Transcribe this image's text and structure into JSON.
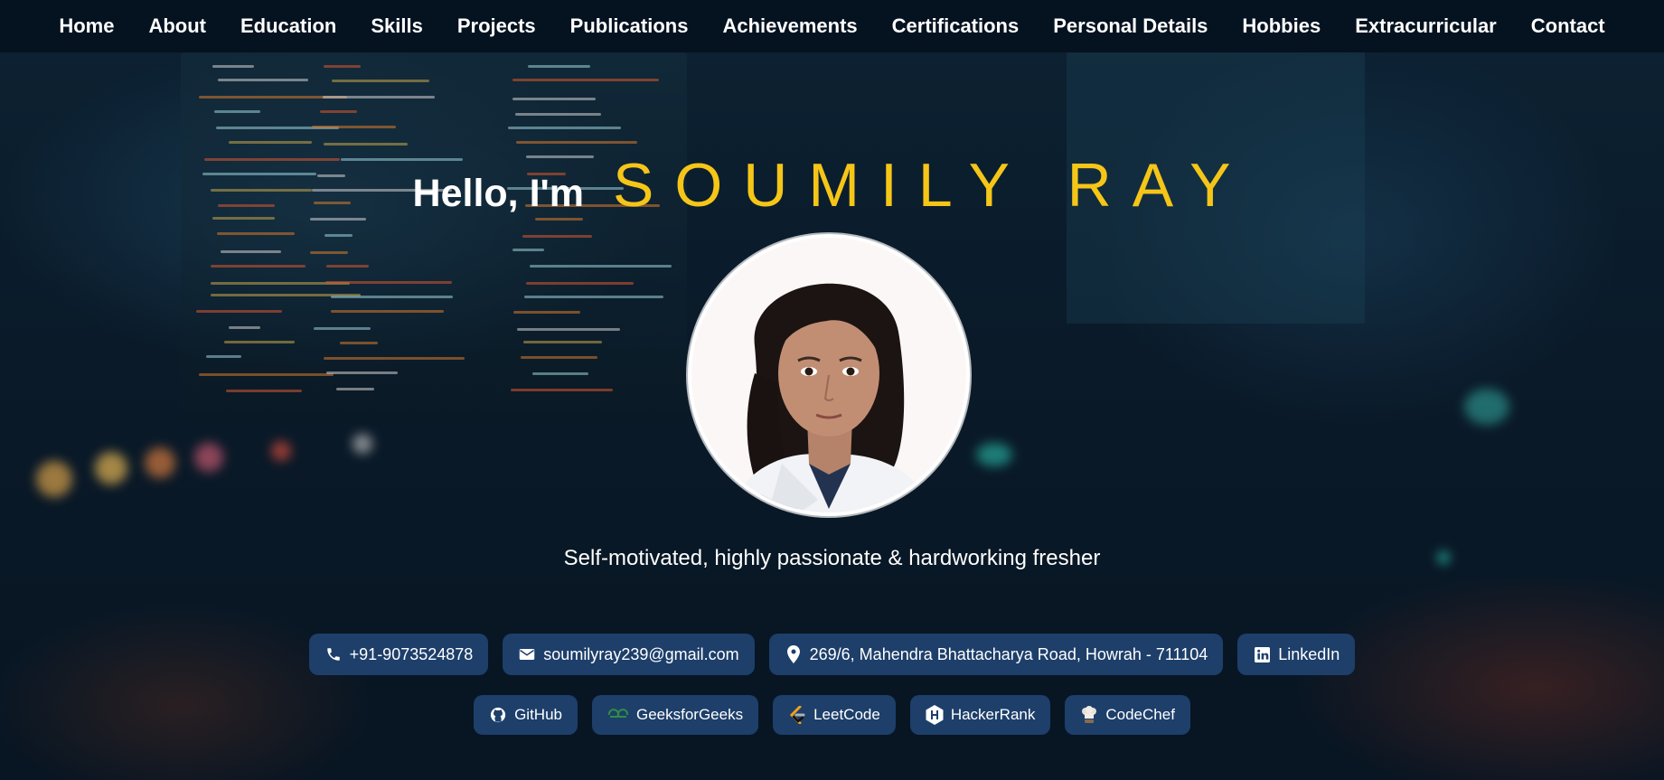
{
  "nav": {
    "items": [
      "Home",
      "About",
      "Education",
      "Skills",
      "Projects",
      "Publications",
      "Achievements",
      "Certifications",
      "Personal Details",
      "Hobbies",
      "Extracurricular",
      "Contact"
    ]
  },
  "hero": {
    "greeting": "Hello, I'm",
    "name": "SOUMILY RAY",
    "tagline": "Self-motivated, highly passionate & hardworking fresher"
  },
  "contacts": {
    "phone": "+91-9073524878",
    "email": "soumilyray239@gmail.com",
    "address": "269/6, Mahendra Bhattacharya Road, Howrah - 711104",
    "linkedin": "LinkedIn"
  },
  "profiles": {
    "github": "GitHub",
    "gfg": "GeeksforGeeks",
    "leetcode": "LeetCode",
    "hackerrank": "HackerRank",
    "codechef": "CodeChef"
  },
  "colors": {
    "accent_name": "#f5c518",
    "chip_bg": "#1d3f6a",
    "nav_bg": "#051220"
  }
}
